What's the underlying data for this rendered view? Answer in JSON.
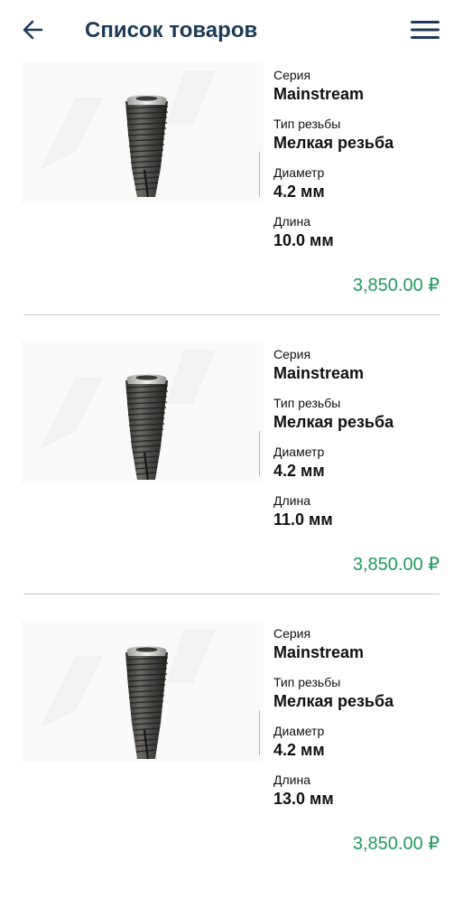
{
  "header": {
    "title": "Список товаров",
    "back_icon": "arrow-left-icon",
    "menu_icon": "hamburger-menu-icon",
    "accent_color": "#1d3b57"
  },
  "products": [
    {
      "image": "dental-implant",
      "series_label": "Серия",
      "series": "Mainstream",
      "thread_label": "Тип резьбы",
      "thread": "Мелкая резьба",
      "diameter_label": "Диаметр",
      "diameter": "4.2 мм",
      "length_label": "Длина",
      "length": "10.0 мм",
      "price": "3,850.00 ₽"
    },
    {
      "image": "dental-implant",
      "series_label": "Серия",
      "series": "Mainstream",
      "thread_label": "Тип резьбы",
      "thread": "Мелкая резьба",
      "diameter_label": "Диаметр",
      "diameter": "4.2 мм",
      "length_label": "Длина",
      "length": "11.0 мм",
      "price": "3,850.00 ₽"
    },
    {
      "image": "dental-implant",
      "series_label": "Серия",
      "series": "Mainstream",
      "thread_label": "Тип резьбы",
      "thread": "Мелкая резьба",
      "diameter_label": "Диаметр",
      "diameter": "4.2 мм",
      "length_label": "Длина",
      "length": "13.0 мм",
      "price": "3,850.00 ₽"
    }
  ],
  "colors": {
    "price": "#1f9a5f",
    "divider": "#c9c9c9"
  }
}
